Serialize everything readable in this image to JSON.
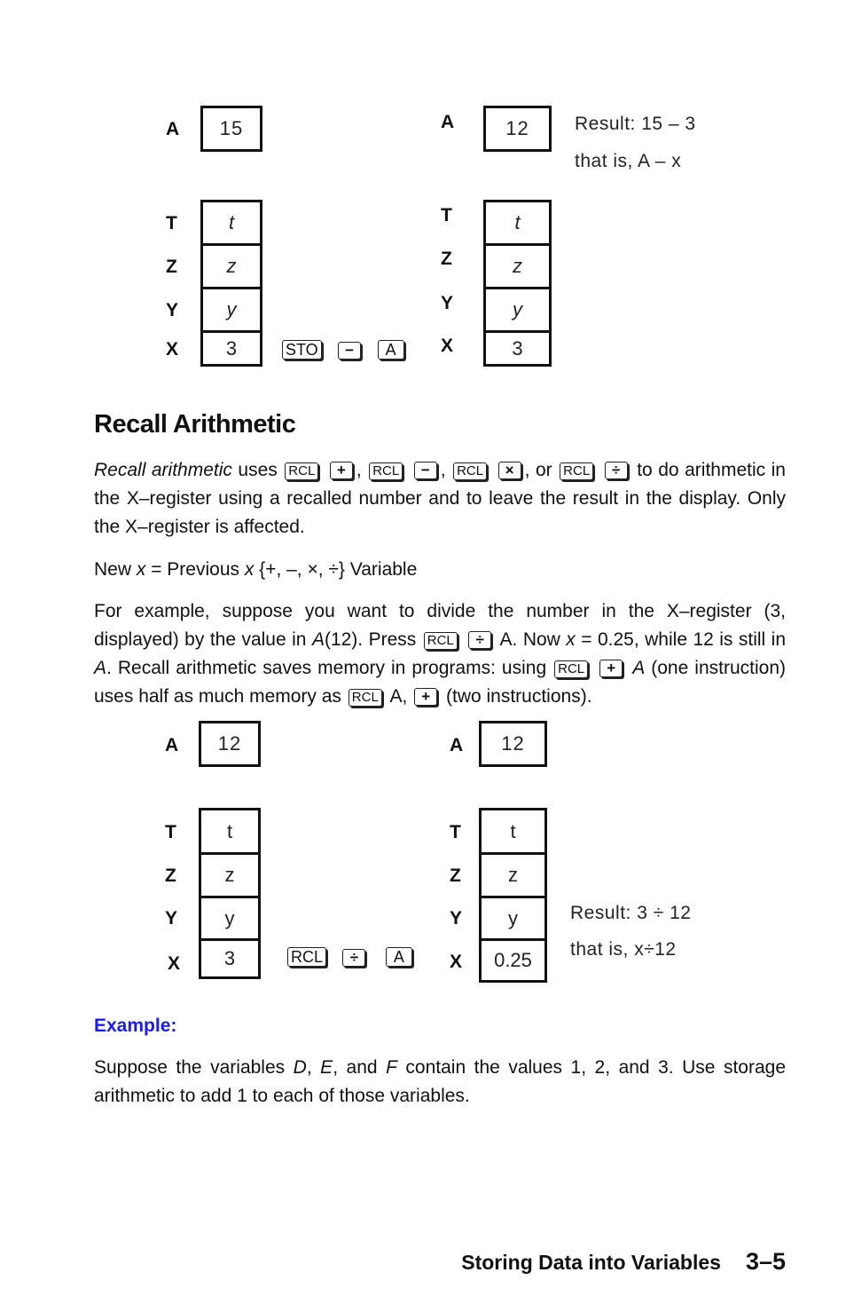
{
  "diagram1": {
    "before": {
      "A_label": "A",
      "A_value": "15",
      "stack_labels": [
        "T",
        "Z",
        "Y",
        "X"
      ],
      "stack_values": [
        "t",
        "z",
        "y",
        "3"
      ]
    },
    "keys": [
      "STO",
      "−",
      "A"
    ],
    "after": {
      "A_label": "A",
      "A_value": "12",
      "stack_labels": [
        "T",
        "Z",
        "Y",
        "X"
      ],
      "stack_values": [
        "t",
        "z",
        "y",
        "3"
      ]
    },
    "result_line1": "Result: 15 – 3",
    "result_line2": "that is, A – x"
  },
  "section": {
    "heading": "Recall Arithmetic",
    "intro": {
      "term": "Recall arithmetic",
      "uses": "uses",
      "key_rcl": "RCL",
      "op_plus": "+",
      "op_minus": "−",
      "op_times": "×",
      "op_divide": "÷",
      "or": ", or",
      "rest": "to do arithmetic in the X–register using a recalled number and to leave the result in the display. Only the X–register is affected."
    },
    "formula": {
      "new": "New ",
      "x1": "x",
      "eq": " = Previous ",
      "x2": "x",
      "ops": " {+, –, ×, ÷} Variable"
    },
    "example_para": {
      "p1": "For example, suppose you want to divide the number in the X–register (3, displayed) by the value in ",
      "A1": "A",
      "p2": "(12). Press ",
      "p3": " A. Now ",
      "x": "x",
      "p4": " = 0.25, while 12 is still in ",
      "A2": "A",
      "p5": ". Recall arithmetic saves memory in programs: using ",
      "A3": "A",
      "p6": " (one instruction) uses half as much memory as ",
      "p7": " A, ",
      "p8": " (two instructions)."
    }
  },
  "diagram2": {
    "before": {
      "A_label": "A",
      "A_value": "12",
      "stack_labels": [
        "T",
        "Z",
        "Y",
        "X"
      ],
      "stack_values": [
        "t",
        "z",
        "y",
        "3"
      ]
    },
    "keys": [
      "RCL",
      "÷",
      "A"
    ],
    "after": {
      "A_label": "A",
      "A_value": "12",
      "stack_labels": [
        "T",
        "Z",
        "Y",
        "X"
      ],
      "stack_values": [
        "t",
        "z",
        "y",
        "0.25"
      ]
    },
    "result_line1": "Result: 3 ÷ 12",
    "result_line2": "that is, x÷12"
  },
  "example": {
    "heading": "Example:",
    "t1": "Suppose the variables ",
    "D": "D",
    "c1": ", ",
    "E": "E",
    "t2": ", and ",
    "F": "F",
    "t3": " contain the values 1, 2, and 3. Use storage arithmetic to add 1 to each of those variables.",
    "color": "#1a1aff"
  },
  "footer": {
    "chapter": "Storing Data into Variables",
    "page": "3–5"
  }
}
